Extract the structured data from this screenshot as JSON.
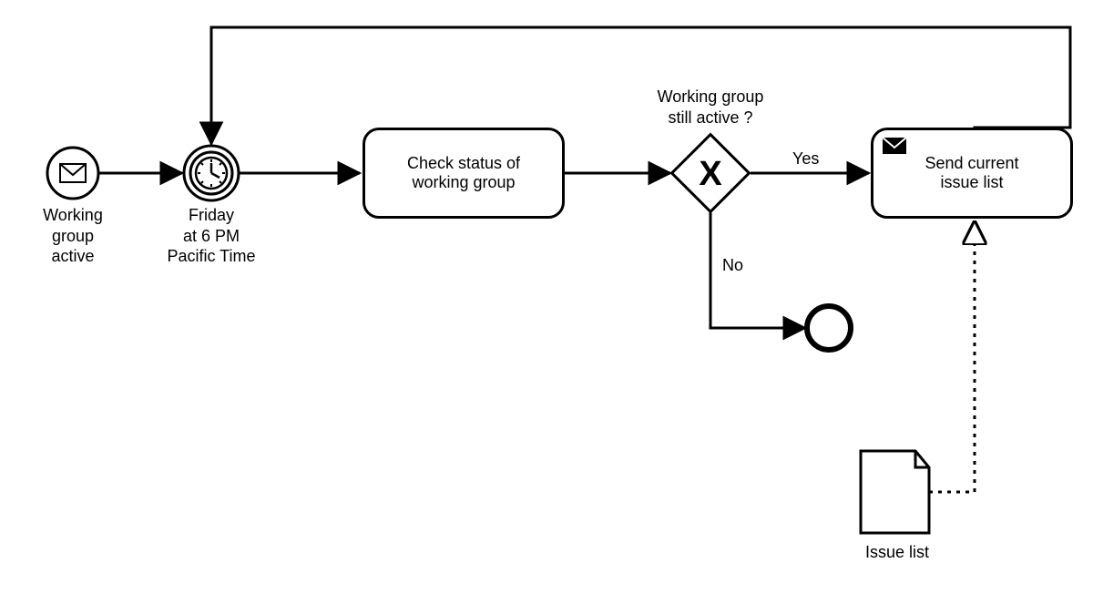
{
  "startEvent": {
    "label": "Working\ngroup\nactive"
  },
  "timerEvent": {
    "label": "Friday\nat 6 PM\nPacific Time"
  },
  "taskCheck": {
    "label": "Check status of\nworking group"
  },
  "gateway": {
    "label": "Working group\nstill active ?",
    "yes": "Yes",
    "no": "No"
  },
  "taskSend": {
    "label": "Send current\nissue list"
  },
  "dataObject": {
    "label": "Issue list"
  }
}
